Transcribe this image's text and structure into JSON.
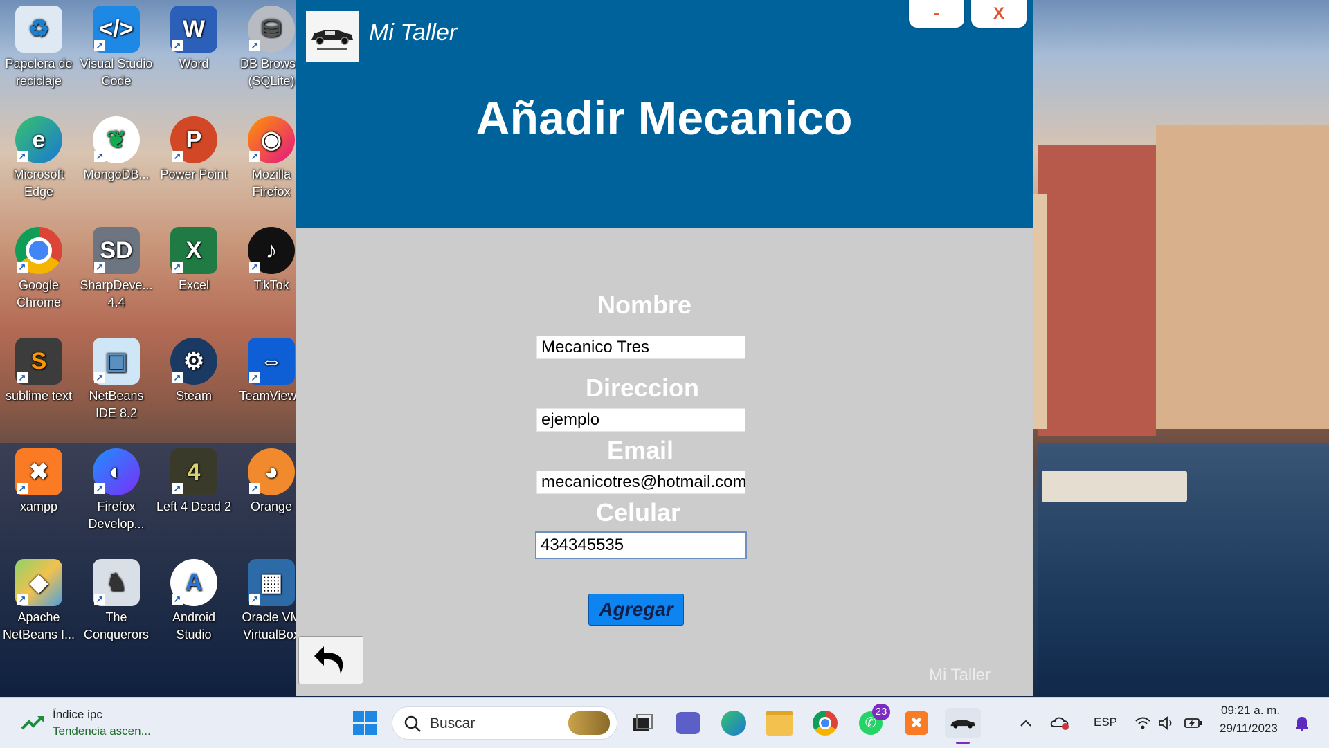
{
  "desktop": {
    "icons": [
      {
        "label": "Papelera de reciclaje",
        "icon": "recycle-bin-icon"
      },
      {
        "label": "Visual Studio Code",
        "icon": "vscode-icon"
      },
      {
        "label": "Word",
        "icon": "word-icon"
      },
      {
        "label": "DB Browse (SQLite)",
        "icon": "database-icon"
      },
      {
        "label": "Microsoft Edge",
        "icon": "edge-icon"
      },
      {
        "label": "MongoDB...",
        "icon": "mongodb-icon"
      },
      {
        "label": "Power Point",
        "icon": "powerpoint-icon"
      },
      {
        "label": "Mozilla Firefox",
        "icon": "firefox-icon"
      },
      {
        "label": "Google Chrome",
        "icon": "chrome-icon"
      },
      {
        "label": "SharpDeve... 4.4",
        "icon": "sharpdevelop-icon"
      },
      {
        "label": "Excel",
        "icon": "excel-icon"
      },
      {
        "label": "TikTok",
        "icon": "tiktok-icon"
      },
      {
        "label": "sublime text",
        "icon": "sublime-icon"
      },
      {
        "label": "NetBeans IDE 8.2",
        "icon": "netbeans-icon"
      },
      {
        "label": "Steam",
        "icon": "steam-icon"
      },
      {
        "label": "TeamViewe",
        "icon": "teamviewer-icon"
      },
      {
        "label": "xampp",
        "icon": "xampp-icon"
      },
      {
        "label": "Firefox Develop...",
        "icon": "firefox-dev-icon"
      },
      {
        "label": "Left 4 Dead 2",
        "icon": "l4d2-icon"
      },
      {
        "label": "Orange",
        "icon": "orange-icon"
      },
      {
        "label": "Apache NetBeans I...",
        "icon": "apache-netbeans-icon"
      },
      {
        "label": "The Conquerors",
        "icon": "conquerors-icon"
      },
      {
        "label": "Android Studio",
        "icon": "android-studio-icon"
      },
      {
        "label": "Oracle VM VirtualBox",
        "icon": "virtualbox-icon"
      }
    ]
  },
  "app": {
    "title": "Mi Taller",
    "minimize_label": "-",
    "close_label": "X",
    "heading": "Añadir Mecanico",
    "form": {
      "nombre_label": "Nombre",
      "nombre_value": "Mecanico Tres",
      "direccion_label": "Direccion",
      "direccion_value": "ejemplo",
      "email_label": "Email",
      "email_value": "mecanicotres@hotmail.com",
      "celular_label": "Celular",
      "celular_value": "434345535"
    },
    "submit_label": "Agregar",
    "footer_brand": "Mi Taller",
    "colors": {
      "header": "#00629a",
      "body": "#cccccc",
      "button": "#0d84f0"
    }
  },
  "taskbar": {
    "widget_title": "Índice ipc",
    "widget_subtitle": "Tendencia ascen...",
    "search_placeholder": "Buscar",
    "whatsapp_badge": "23",
    "language": "ESP",
    "time": "09:21 a. m.",
    "date": "29/11/2023"
  }
}
